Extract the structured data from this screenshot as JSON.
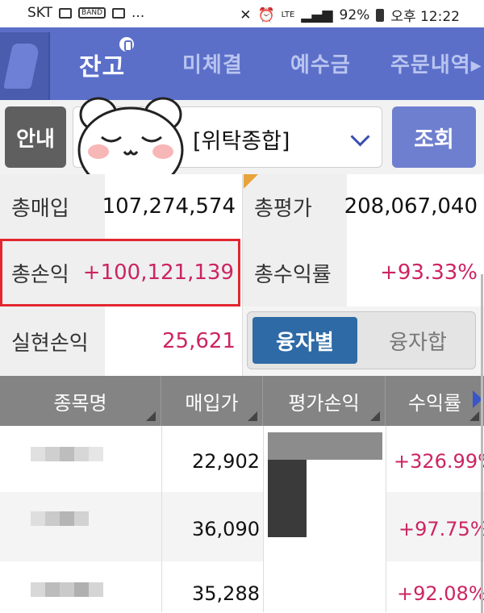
{
  "status_bar": {
    "carrier": "SKT",
    "band_label": "BAND",
    "more": "...",
    "network": "LTE",
    "battery": "92%",
    "time": "오후 12:22"
  },
  "tabs": [
    {
      "label": "잔고",
      "active": true
    },
    {
      "label": "미체결",
      "active": false
    },
    {
      "label": "예수금",
      "active": false
    },
    {
      "label": "주문내역▸",
      "active": false
    }
  ],
  "controls": {
    "guide_button": "안내",
    "account_type": "[위탁종합]",
    "search_button": "조회"
  },
  "summary": {
    "total_purchase_label": "총매입",
    "total_purchase_value": "107,274,574",
    "total_eval_label": "총평가",
    "total_eval_value": "208,067,040",
    "total_pnl_label": "총손익",
    "total_pnl_value": "+100,121,139",
    "total_return_label": "총수익률",
    "total_return_value": "+93.33%",
    "realized_pnl_label": "실현손익",
    "realized_pnl_value": "25,621"
  },
  "loan_toggle": {
    "by_loan": "융자별",
    "loan_sum": "융자합",
    "selected": "융자별"
  },
  "table": {
    "headers": [
      "종목명",
      "매입가",
      "평가손익",
      "수익률"
    ],
    "rows": [
      {
        "buy_price": "22,902",
        "return_rate": "+326.99%"
      },
      {
        "buy_price": "36,090",
        "return_rate": "+97.75%"
      },
      {
        "buy_price": "35,288",
        "return_rate": "+92.08%"
      }
    ]
  },
  "colors": {
    "tab_bar": "#5b6fc9",
    "positive": "#cc2462",
    "highlight_box": "#e3262f",
    "toggle_active": "#2e6aa6",
    "table_header": "#848484"
  }
}
